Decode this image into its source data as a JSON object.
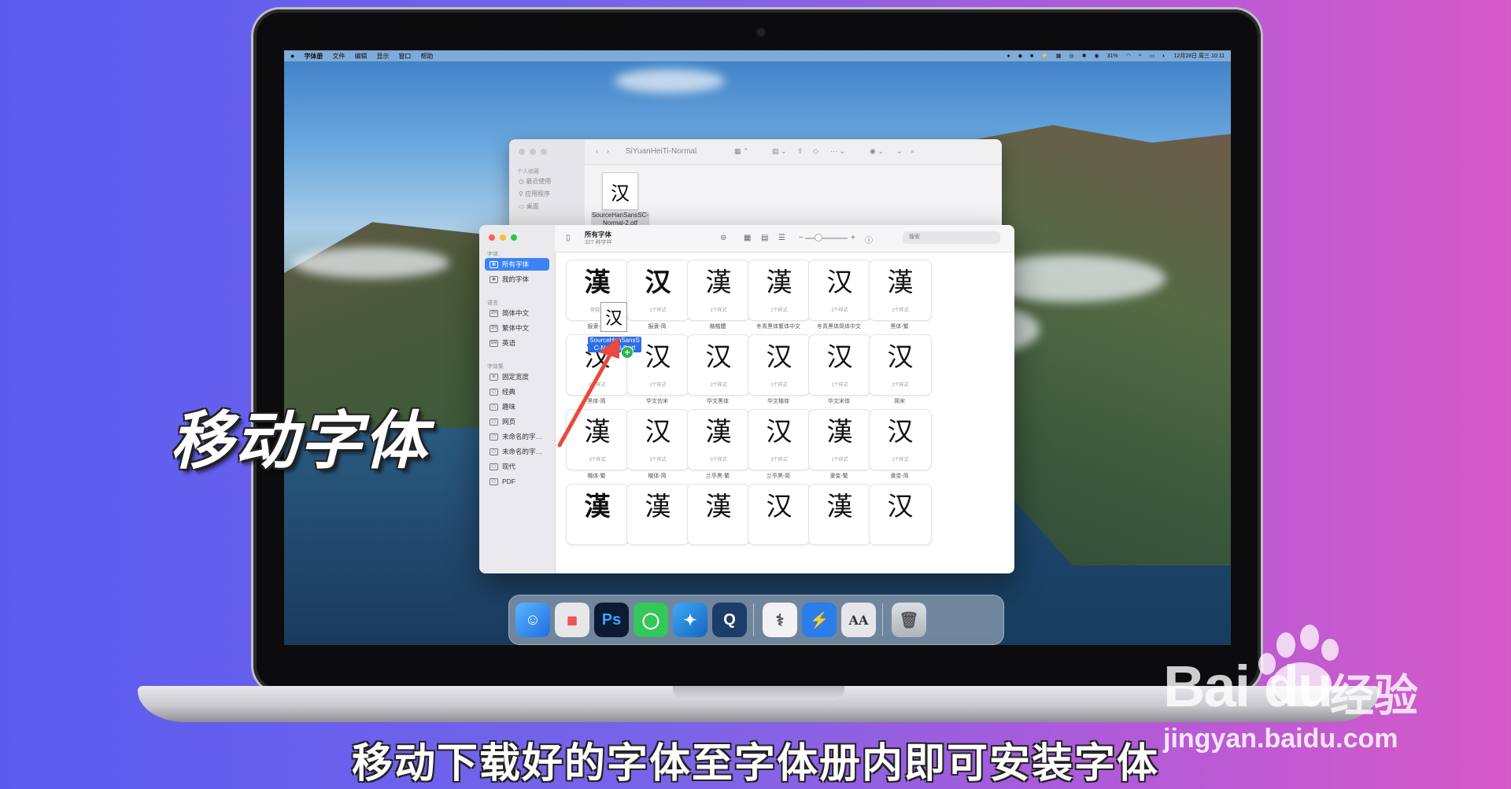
{
  "menubar": {
    "apple": "",
    "items": [
      "字体册",
      "文件",
      "编辑",
      "显示",
      "窗口",
      "帮助"
    ],
    "battery": "31%",
    "clock": "12月28日 周三  10:11"
  },
  "finder": {
    "title": "SiYuanHeiTi-Normal",
    "sidebar_section": "个人收藏",
    "sidebar_items": [
      "最近使用",
      "应用程序",
      "桌面"
    ],
    "file_glyph": "汉",
    "file_name": "SourceHanSansSC-Normal-2.otf"
  },
  "fontbook": {
    "title": "所有字体",
    "subtitle": "327 种字样",
    "search_placeholder": "搜索",
    "sections": [
      {
        "label": "字体",
        "items": [
          {
            "icon": "grid",
            "label": "所有字体",
            "selected": true
          },
          {
            "icon": "user",
            "label": "我的字体"
          }
        ]
      },
      {
        "label": "语言",
        "items": [
          {
            "icon": "ZH",
            "label": "简体中文"
          },
          {
            "icon": "ZH",
            "label": "繁体中文"
          },
          {
            "icon": "EN",
            "label": "英语"
          }
        ]
      },
      {
        "label": "字体集",
        "items": [
          {
            "icon": "gear",
            "label": "固定宽度"
          },
          {
            "icon": "doc",
            "label": "经典"
          },
          {
            "icon": "doc",
            "label": "趣味"
          },
          {
            "icon": "doc",
            "label": "网页"
          },
          {
            "icon": "doc",
            "label": "未命名的字…"
          },
          {
            "icon": "doc",
            "label": "未命名的字…"
          },
          {
            "icon": "doc",
            "label": "现代"
          },
          {
            "icon": "doc",
            "label": "PDF"
          }
        ]
      }
    ],
    "tiles": [
      {
        "glyph": "漢",
        "count": "常规体",
        "name": "报隶-繁"
      },
      {
        "glyph": "汉",
        "count": "1个样式",
        "name": "报隶-简"
      },
      {
        "glyph": "漢",
        "count": "1个样式",
        "name": "楷楷體"
      },
      {
        "glyph": "漢",
        "count": "2个样式",
        "name": "冬青黑体繁体中文"
      },
      {
        "glyph": "汉",
        "count": "2个样式",
        "name": "冬青黑体简体中文"
      },
      {
        "glyph": "漢",
        "count": "2个样式",
        "name": "黑体-繁"
      },
      {
        "glyph": "汉",
        "count": "2个样式",
        "name": "黑体-简"
      },
      {
        "glyph": "汉",
        "count": "1个样式",
        "name": "华文仿宋"
      },
      {
        "glyph": "汉",
        "count": "2个样式",
        "name": "华文黑体"
      },
      {
        "glyph": "汉",
        "count": "1个样式",
        "name": "华文楷体"
      },
      {
        "glyph": "汉",
        "count": "1个样式",
        "name": "华文宋体"
      },
      {
        "glyph": "汉",
        "count": "2个样式",
        "name": "简宋"
      },
      {
        "glyph": "漢",
        "count": "3个样式",
        "name": "楷体-繁"
      },
      {
        "glyph": "汉",
        "count": "3个样式",
        "name": "楷体-简"
      },
      {
        "glyph": "漢",
        "count": "3个样式",
        "name": "兰亭黑-繁"
      },
      {
        "glyph": "汉",
        "count": "3个样式",
        "name": "兰亭黑-简"
      },
      {
        "glyph": "漢",
        "count": "1个样式",
        "name": "隶变-繁"
      },
      {
        "glyph": "汉",
        "count": "1个样式",
        "name": "隶变-简"
      },
      {
        "glyph": "漢",
        "count": "",
        "name": ""
      },
      {
        "glyph": "漢",
        "count": "",
        "name": ""
      },
      {
        "glyph": "漢",
        "count": "",
        "name": ""
      },
      {
        "glyph": "汉",
        "count": "",
        "name": ""
      },
      {
        "glyph": "漢",
        "count": "",
        "name": ""
      },
      {
        "glyph": "汉",
        "count": "",
        "name": ""
      }
    ]
  },
  "drag": {
    "glyph": "汉",
    "label_line1": "SourceHanSansS",
    "label_line2": "C-Normal-2.otf",
    "badge": "+"
  },
  "dock": {
    "apps": [
      "finder-app",
      "launchpad-app",
      "photoshop-app",
      "messages-app",
      "safari-app",
      "quicktime-app",
      "preview-app",
      "xcode-app",
      "fontbook-app",
      "trash"
    ],
    "photoshop_label": "Ps",
    "fontbook_label": "AA"
  },
  "overlay": {
    "title": "移动字体",
    "caption": "移动下载好的字体至字体册内即可安装字体"
  },
  "watermark": {
    "brand": "Bai du",
    "brand_cn": "经验",
    "url": "jingyan.baidu.com"
  },
  "colors": {
    "accent": "#3b83f5",
    "drag_label": "#2a6ee8",
    "arrow": "#e84a3c"
  }
}
